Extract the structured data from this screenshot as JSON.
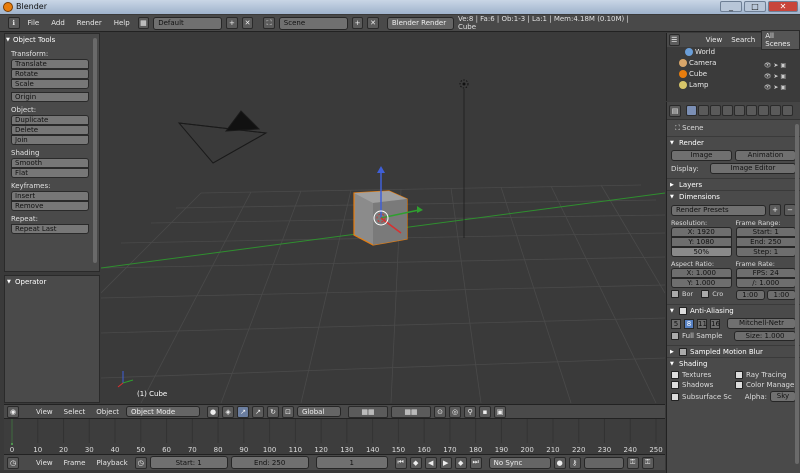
{
  "window": {
    "title": "Blender",
    "minimize": "_",
    "maximize": "□",
    "close": "✕"
  },
  "info_header": {
    "menus": [
      "File",
      "Add",
      "Render",
      "Help"
    ],
    "screen_layout": "Default",
    "scene": "Scene",
    "render_engine": "Blender Render",
    "stats": "Ve:8 | Fa:6 | Ob:1-3 | La:1 | Mem:4.18M (0.10M) | Cube"
  },
  "tool_shelf": {
    "title": "Object Tools",
    "transform_label": "Transform:",
    "transform": [
      "Translate",
      "Rotate",
      "Scale"
    ],
    "origin": "Origin",
    "object_label": "Object:",
    "object": [
      "Duplicate",
      "Delete",
      "Join"
    ],
    "shading_label": "Shading",
    "shading": [
      "Smooth",
      "Flat"
    ],
    "keyframes_label": "Keyframes:",
    "keyframes": [
      "Insert",
      "Remove"
    ],
    "repeat_label": "Repeat:",
    "repeat": "Repeat Last"
  },
  "operator_panel": {
    "title": "Operator"
  },
  "viewport": {
    "object_label": "(1) Cube"
  },
  "view3d_header": {
    "menus": [
      "View",
      "Select",
      "Object"
    ],
    "mode": "Object Mode",
    "orientation": "Global"
  },
  "timeline": {
    "ticks": [
      "0",
      "10",
      "20",
      "30",
      "40",
      "50",
      "60",
      "70",
      "80",
      "90",
      "100",
      "110",
      "120",
      "130",
      "140",
      "150",
      "160",
      "170",
      "180",
      "190",
      "200",
      "210",
      "220",
      "230",
      "240",
      "250"
    ]
  },
  "timeline_header": {
    "menus": [
      "View",
      "Frame",
      "Playback"
    ],
    "start": "Start: 1",
    "end": "End: 250",
    "current": "1",
    "sync": "No Sync"
  },
  "outliner": {
    "view": "View",
    "search": "Search",
    "all_scenes": "All Scenes",
    "items": [
      "World",
      "Camera",
      "Cube",
      "Lamp"
    ]
  },
  "properties": {
    "scene": "Scene",
    "render": {
      "title": "Render",
      "image": "Image",
      "animation": "Animation",
      "display_label": "Display:",
      "display": "Image Editor"
    },
    "layers": "Layers",
    "dimensions": {
      "title": "Dimensions",
      "presets": "Render Presets",
      "resolution_label": "Resolution:",
      "res_x": "X: 1920",
      "res_y": "Y: 1080",
      "res_pct": "50%",
      "frame_range_label": "Frame Range:",
      "start": "Start: 1",
      "end": "End: 250",
      "step": "Step: 1",
      "aspect_label": "Aspect Ratio:",
      "aspect_x": "X: 1.000",
      "aspect_y": "Y: 1.000",
      "border": "Bor",
      "crop": "Cro",
      "frame_rate_label": "Frame Rate:",
      "fps": "FPS: 24",
      "fps_base": "/: 1.000",
      "time_old": "1:00",
      "time_new": "1:00"
    },
    "anti_aliasing": {
      "title": "Anti-Aliasing",
      "samples": [
        "5",
        "8",
        "11",
        "16"
      ],
      "filter": "Mitchell-Netr",
      "full_sample": "Full Sample",
      "size": "Size: 1.000"
    },
    "motion_blur": "Sampled Motion Blur",
    "shading": {
      "title": "Shading",
      "textures": "Textures",
      "ray_tracing": "Ray Tracing",
      "shadows": "Shadows",
      "color_manage": "Color Manage",
      "subsurface": "Subsurface Sc",
      "alpha_label": "Alpha:",
      "alpha": "Sky"
    }
  },
  "colors": {
    "accent": "#e87d0d",
    "selection_blue": "#5680c2"
  }
}
